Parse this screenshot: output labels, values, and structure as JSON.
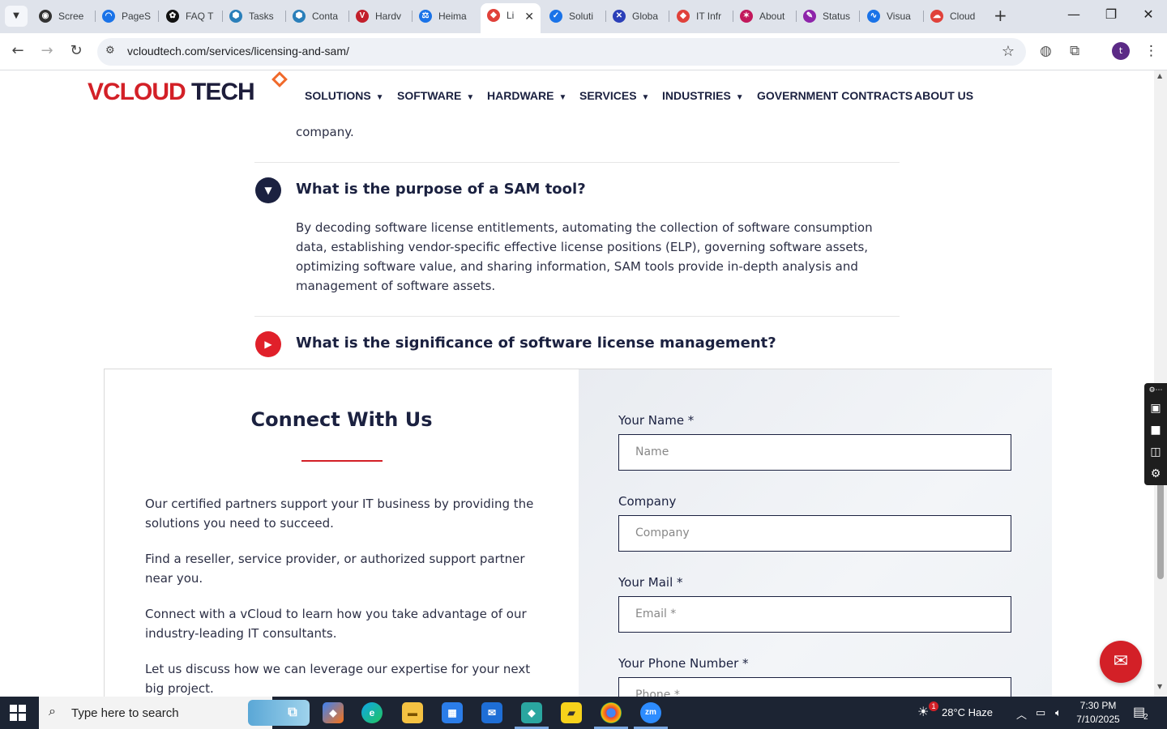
{
  "browser": {
    "tabs": [
      {
        "label": "Scree",
        "icon": "screen-icon",
        "color": "#333333"
      },
      {
        "label": "PageS",
        "icon": "gauge-icon",
        "color": "#1a73e8"
      },
      {
        "label": "FAQ T",
        "icon": "openai-icon",
        "color": "#111111"
      },
      {
        "label": "Tasks",
        "icon": "hex-icon",
        "color": "#2a7fba"
      },
      {
        "label": "Conta",
        "icon": "hex-icon",
        "color": "#2a7fba"
      },
      {
        "label": "Hardv",
        "icon": "v-logo-icon",
        "color": "#c21f2b"
      },
      {
        "label": "Heima",
        "icon": "scale-icon",
        "color": "#1a73e8"
      },
      {
        "label": "Li",
        "icon": "vcloud-icon",
        "color": "#e0413a"
      },
      {
        "label": "Soluti",
        "icon": "check-icon",
        "color": "#1a73e8"
      },
      {
        "label": "Globa",
        "icon": "x-logo-icon",
        "color": "#2b3fb8"
      },
      {
        "label": "IT Infr",
        "icon": "vcloud-icon",
        "color": "#e0413a"
      },
      {
        "label": "About",
        "icon": "bolt-icon",
        "color": "#c2185b"
      },
      {
        "label": "Status",
        "icon": "feather-icon",
        "color": "#8e24aa"
      },
      {
        "label": "Visua",
        "icon": "pulse-icon",
        "color": "#1a73e8"
      },
      {
        "label": "Cloud",
        "icon": "cloud-icon",
        "color": "#e0413a"
      }
    ],
    "url": "vcloudtech.com/services/licensing-and-sam/",
    "profile_initial": "t"
  },
  "site": {
    "logo_v": "V",
    "logo_cloud": "CLOUD",
    "logo_tech": " TECH",
    "nav": [
      {
        "label": "SOLUTIONS",
        "dropdown": true
      },
      {
        "label": "SOFTWARE",
        "dropdown": true
      },
      {
        "label": "HARDWARE",
        "dropdown": true
      },
      {
        "label": "SERVICES",
        "dropdown": true
      },
      {
        "label": "INDUSTRIES",
        "dropdown": true
      },
      {
        "label": "GOVERNMENT CONTRACTS",
        "dropdown": false
      },
      {
        "label": "ABOUT US",
        "dropdown": false
      }
    ]
  },
  "faq": {
    "prev_tail": "company.",
    "items": [
      {
        "question": "What is the purpose of a SAM tool?",
        "expanded": true,
        "answer": "By decoding software license entitlements, automating the collection of software consumption data, establishing vendor-specific effective license positions (ELP), governing software assets, optimizing software value, and sharing information, SAM tools provide in-depth analysis and management of software assets."
      },
      {
        "question": "What is the significance of software license management?",
        "expanded": false,
        "answer": ""
      }
    ],
    "colors": {
      "expanded": "#1b2140",
      "collapsed": "#e0202a"
    }
  },
  "connect": {
    "title": "Connect With Us",
    "paragraphs": [
      "Our certified partners support your IT business by providing the solutions you need to succeed.",
      "Find a reseller, service provider, or authorized support partner near you.",
      "Connect with a vCloud to learn how you take advantage of our industry-leading IT consultants.",
      "Let us discuss how we can leverage our expertise for your next big project."
    ],
    "form": {
      "name_label": "Your Name *",
      "name_placeholder": "Name",
      "company_label": "Company",
      "company_placeholder": "Company",
      "mail_label": "Your Mail *",
      "mail_placeholder": "Email *",
      "phone_label": "Your Phone Number *",
      "phone_placeholder": "Phone *"
    }
  },
  "taskbar": {
    "search_placeholder": "Type here to search",
    "weather_badge": "1",
    "weather": "28°C  Haze",
    "time": "7:30 PM",
    "date": "7/10/2025",
    "notifications": "2"
  }
}
